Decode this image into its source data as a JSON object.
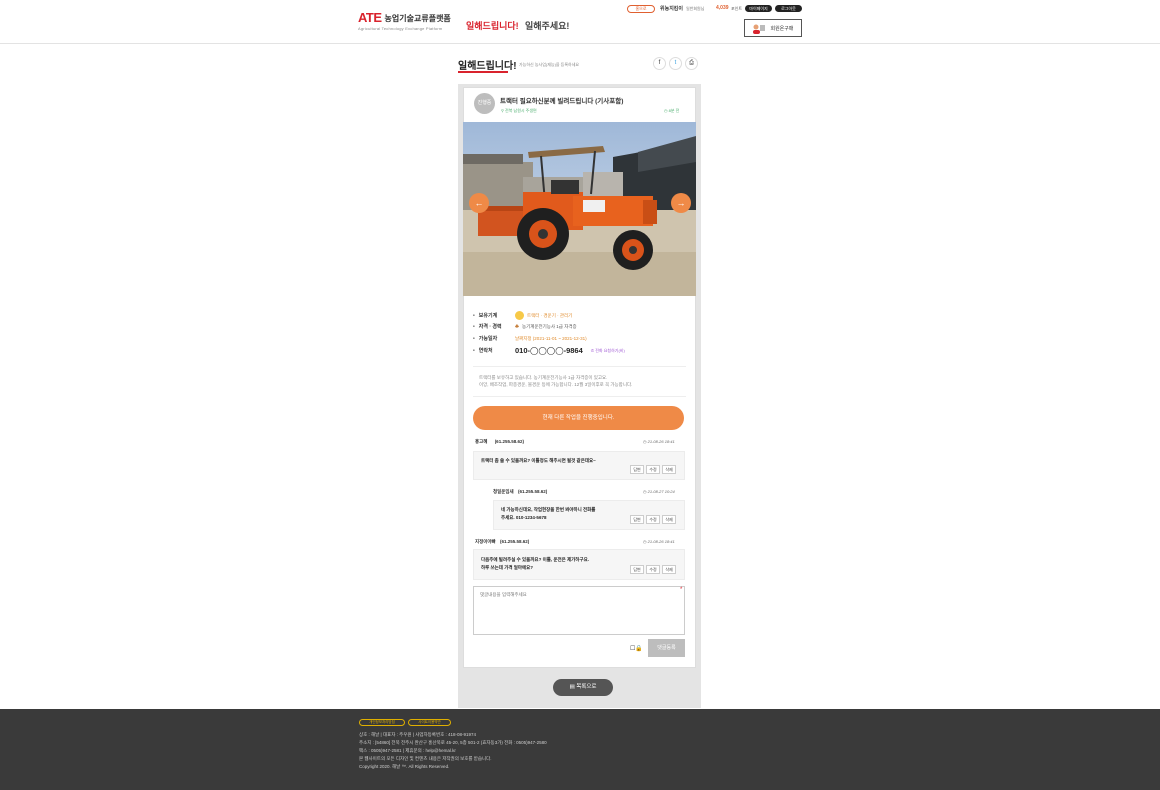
{
  "header": {
    "logo_mark": "ATE",
    "logo_title": "농업기술교류플랫폼",
    "logo_sub": "Agricultural Technology Exchange Platform",
    "nav": [
      "일해드립니다!",
      "일해주세요!"
    ],
    "join_label": "홈으로",
    "user_name": "위농지킴이",
    "user_role": "일반회원님",
    "points": "4,039",
    "points_unit": "포인트",
    "mypage": "마이페이지",
    "logout": "로그아웃",
    "member_button": "회원온구매"
  },
  "title_bar": {
    "title": "일해드립니다!",
    "desc": "가능하신 농사업(재능)을 등록하세요",
    "share": [
      "f",
      "t",
      "p"
    ]
  },
  "post": {
    "status": "진행중",
    "title": "트랙터 필요하신분께 빌려드립니다 (기사포함)",
    "location": "전북 남원시 주생면",
    "time": "8분 전",
    "info": [
      {
        "label": "보유기계",
        "value": "트랙터 · 경운기 · 관리기"
      },
      {
        "label": "자격 · 경력",
        "value": "농기계운전기능사 1급 자격증"
      },
      {
        "label": "가능일자",
        "value": "날짜지정 (2021-11-01 ~ 2021-12-31)"
      },
      {
        "label": "연락처",
        "value": "010-◯◯◯◯-9864"
      }
    ],
    "contact_link": "전화 요청하기(비)",
    "description": [
      "트랙터를 보유하고 있습니다. 농기계운전기능사 1급 자격증이 있고요.",
      "이앙, 배조작업, 파종경운, 볼경운 등에 가능합니다. 12월 3일이후로 꼭 가능합니다."
    ],
    "progress_button": "현재 다른 작업을 진행중입니다."
  },
  "comments": [
    {
      "author": "홍고혜",
      "ip": "(61.255.58.62)",
      "date": "21-08-26 18:41",
      "lines": [
        "트랙터 좀 쓸 수 있을까요? 이틀정도 해주시면 될것 같은데요~"
      ],
      "reply": false
    },
    {
      "author": "청일운임새",
      "ip": "(61.255.58.62)",
      "date": "21-08-27 10:24",
      "lines": [
        "네 가능하신데요, 작업현장을 한번 봐야하니 전화를",
        "주세요. 010-1234-5678"
      ],
      "reply": true
    },
    {
      "author": "지정이아빠",
      "ip": "(61.255.58.62)",
      "date": "21-08-26 18:41",
      "lines": [
        "다음주에 빌려주실 수 있을까요? 이틀, 운전은 제가하구요.",
        "하루 쓰는데 가격 얼마에요?"
      ],
      "reply": false
    }
  ],
  "comment_actions": [
    "답변",
    "수정",
    "삭제"
  ],
  "comment_form": {
    "placeholder": "댓글내용을 입력해주세요",
    "submit": "댓글등록",
    "list_button": "목록으로"
  },
  "footer": {
    "links": [
      "개인정보처리방침",
      "사이트이용약관"
    ],
    "lines": [
      "상호 : 해날    |    대표자 : 주우원    |    사업자등록번호 : 418-08-91974",
      "주소지 : [54860] 전북 전주시 완산구 홍산북로 45-20, 5층 501-2 (효자동3가)    전화 : 0505)947-2580",
      "팩스 : 0505)947-2581    |    제휴문의 : help@hemal.kr",
      "본 웹사이트의 모든 디자인 및 컨텐츠 내용은 저작권의 보호를 받습니다.",
      "Copyright 2020. 해날 ™. All Rights Reserved."
    ]
  },
  "colors": {
    "brand_red": "#d9232d",
    "accent_orange": "#ef8a47",
    "green": "#4cae6e",
    "footer_bg": "#3a3a3a"
  }
}
